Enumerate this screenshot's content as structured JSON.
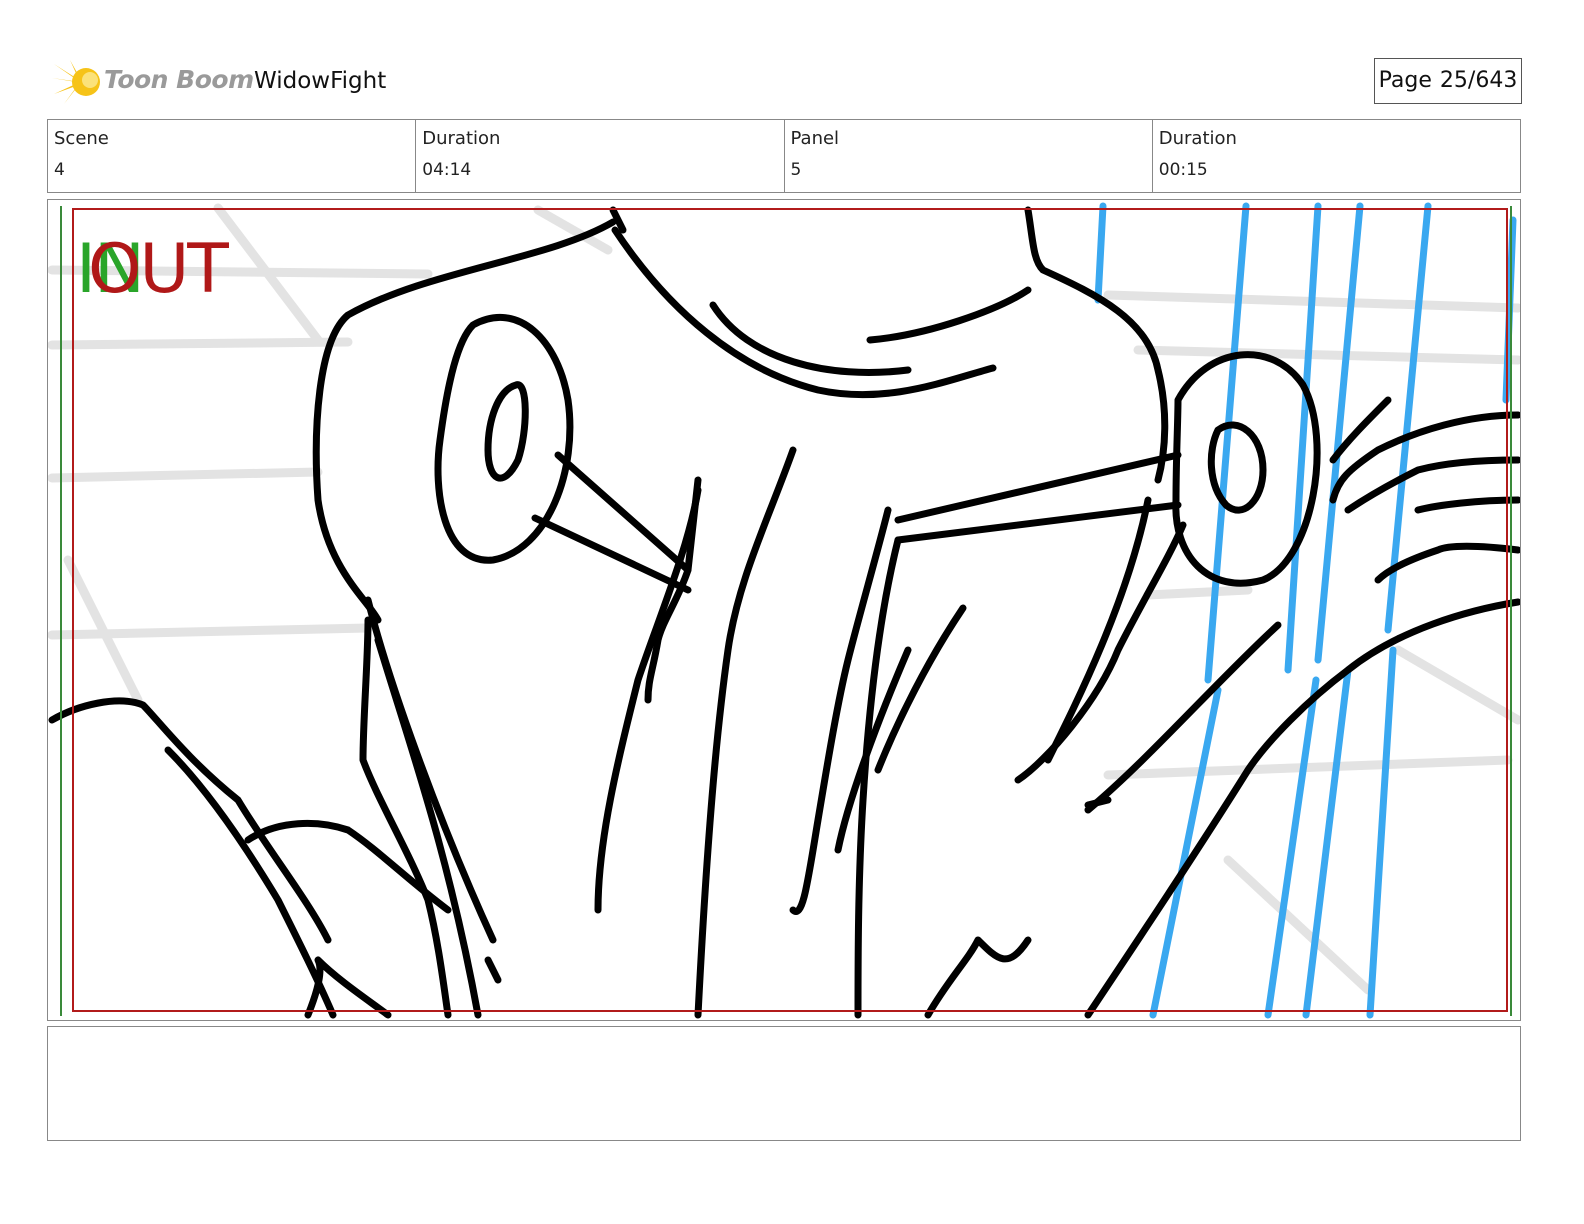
{
  "header": {
    "brand": "Toon Boom",
    "project": "WidowFight",
    "page_label": "Page",
    "page_value": "25/643"
  },
  "info": [
    {
      "label": "Scene",
      "value": "4"
    },
    {
      "label": "Duration",
      "value": "04:14"
    },
    {
      "label": "Panel",
      "value": "5"
    },
    {
      "label": "Duration",
      "value": "00:15"
    }
  ],
  "panel": {
    "in_label": "IN",
    "out_label": "OUT"
  },
  "notes": {
    "text": ""
  },
  "colors": {
    "safe_frame": "#b21b1b",
    "action_frame": "#3a8a3a",
    "in_color": "#2aa52a",
    "out_color": "#b01818",
    "background_lines": "#3aa8f0"
  }
}
